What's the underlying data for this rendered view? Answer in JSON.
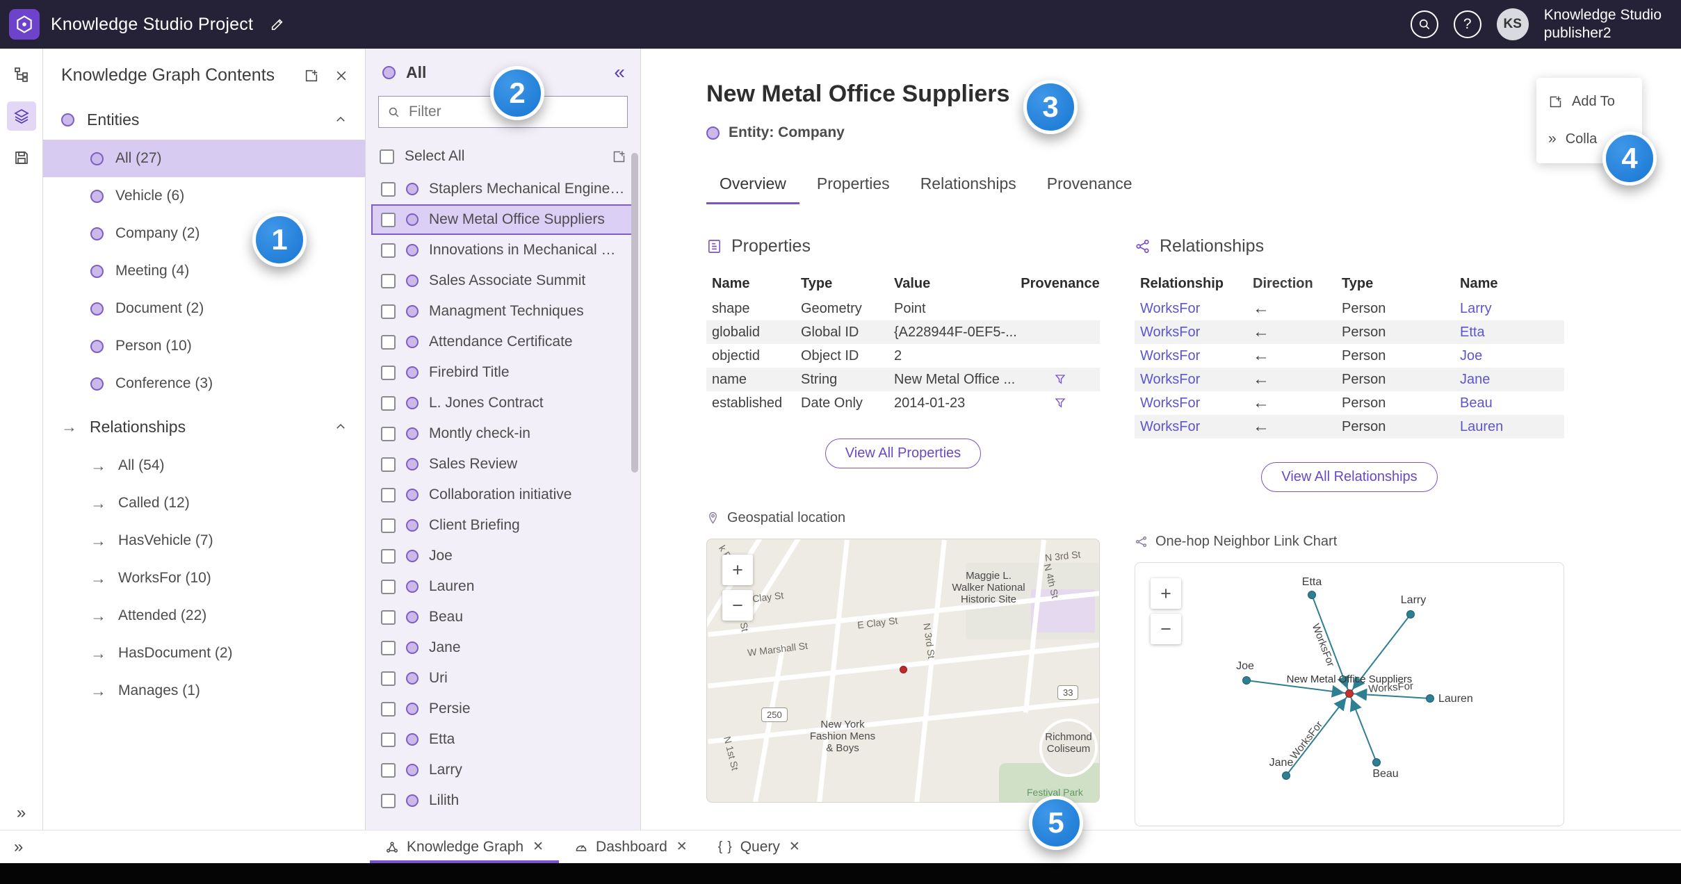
{
  "topbar": {
    "title": "Knowledge Studio Project",
    "user_line1": "Knowledge Studio",
    "user_line2": "publisher2",
    "avatar_initials": "KS"
  },
  "contents_panel": {
    "title": "Knowledge Graph Contents",
    "entities_header": "Entities",
    "relationships_header": "Relationships",
    "entities": [
      {
        "label": "All (27)",
        "selected": true
      },
      {
        "label": "Vehicle (6)"
      },
      {
        "label": "Company (2)"
      },
      {
        "label": "Meeting (4)"
      },
      {
        "label": "Document (2)"
      },
      {
        "label": "Person (10)"
      },
      {
        "label": "Conference (3)"
      }
    ],
    "relationships": [
      {
        "label": "All (54)"
      },
      {
        "label": "Called (12)"
      },
      {
        "label": "HasVehicle (7)"
      },
      {
        "label": "WorksFor (10)"
      },
      {
        "label": "Attended (22)"
      },
      {
        "label": "HasDocument (2)"
      },
      {
        "label": "Manages (1)"
      }
    ]
  },
  "list_panel": {
    "header": "All",
    "filter_placeholder": "Filter",
    "select_all_label": "Select All",
    "items": [
      {
        "label": "Staplers Mechanical Engineering"
      },
      {
        "label": "New Metal Office Suppliers",
        "selected": true
      },
      {
        "label": "Innovations in Mechanical Engin..."
      },
      {
        "label": "Sales Associate Summit"
      },
      {
        "label": "Managment Techniques"
      },
      {
        "label": "Attendance Certificate"
      },
      {
        "label": "Firebird Title"
      },
      {
        "label": "L. Jones Contract"
      },
      {
        "label": "Montly check-in"
      },
      {
        "label": "Sales Review"
      },
      {
        "label": "Collaboration initiative"
      },
      {
        "label": "Client Briefing"
      },
      {
        "label": "Joe"
      },
      {
        "label": "Lauren"
      },
      {
        "label": "Beau"
      },
      {
        "label": "Jane"
      },
      {
        "label": "Uri"
      },
      {
        "label": "Persie"
      },
      {
        "label": "Etta"
      },
      {
        "label": "Larry"
      },
      {
        "label": "Lilith"
      }
    ]
  },
  "detail": {
    "title": "New Metal Office Suppliers",
    "entity_line": "Entity: Company",
    "tabs": [
      {
        "label": "Overview",
        "selected": true
      },
      {
        "label": "Properties"
      },
      {
        "label": "Relationships"
      },
      {
        "label": "Provenance"
      }
    ],
    "properties_section": {
      "title": "Properties",
      "columns": [
        "Name",
        "Type",
        "Value",
        "Provenance"
      ],
      "rows": [
        {
          "name": "shape",
          "type": "Geometry",
          "value": "Point",
          "provenance": false
        },
        {
          "name": "globalid",
          "type": "Global ID",
          "value": "{A228944F-0EF5-...",
          "provenance": false
        },
        {
          "name": "objectid",
          "type": "Object ID",
          "value": "2",
          "provenance": false
        },
        {
          "name": "name",
          "type": "String",
          "value": "New Metal Office ...",
          "provenance": true
        },
        {
          "name": "established",
          "type": "Date Only",
          "value": "2014-01-23",
          "provenance": true
        }
      ],
      "view_all_label": "View All Properties"
    },
    "relationships_section": {
      "title": "Relationships",
      "columns": [
        "Relationship",
        "Direction",
        "Type",
        "Name"
      ],
      "rows": [
        {
          "relationship": "WorksFor",
          "direction": "←",
          "type": "Person",
          "name": "Larry"
        },
        {
          "relationship": "WorksFor",
          "direction": "←",
          "type": "Person",
          "name": "Etta"
        },
        {
          "relationship": "WorksFor",
          "direction": "←",
          "type": "Person",
          "name": "Joe"
        },
        {
          "relationship": "WorksFor",
          "direction": "←",
          "type": "Person",
          "name": "Jane"
        },
        {
          "relationship": "WorksFor",
          "direction": "←",
          "type": "Person",
          "name": "Beau"
        },
        {
          "relationship": "WorksFor",
          "direction": "←",
          "type": "Person",
          "name": "Lauren"
        }
      ],
      "view_all_label": "View All Relationships"
    },
    "map_section": {
      "title": "Geospatial location",
      "labels": {
        "k_rd": "k Rd",
        "w_clay": "W Clay St",
        "e_clay": "E Clay St",
        "marshall": "arshall St",
        "w_marshall": "W Marshall St",
        "n3rd_top": "N 3rd St",
        "n3rd_mid": "N 3rd St",
        "n4th": "N 4th St",
        "n1st": "N 1st St",
        "route_250": "250",
        "route_33": "33",
        "maggie": "Maggie L.\nWalker National\nHistoric Site",
        "ny_fashion": "New York\nFashion Mens\n& Boys",
        "coliseum": "Richmond\nColiseum",
        "festival": "Festival Park"
      }
    },
    "link_chart_section": {
      "title": "One-hop Neighbor Link Chart",
      "center": "New Metal Office Suppliers",
      "nodes": [
        "Etta",
        "Larry",
        "Joe",
        "Lauren",
        "Jane",
        "Beau"
      ],
      "edge_label": "WorksFor"
    }
  },
  "float_panel": {
    "add_to": "Add To",
    "collapse": "Colla"
  },
  "bottom_tabs": [
    {
      "label": "Knowledge Graph",
      "selected": true
    },
    {
      "label": "Dashboard"
    },
    {
      "label": "Query"
    }
  ],
  "callouts": [
    "1",
    "2",
    "3",
    "4",
    "5"
  ]
}
